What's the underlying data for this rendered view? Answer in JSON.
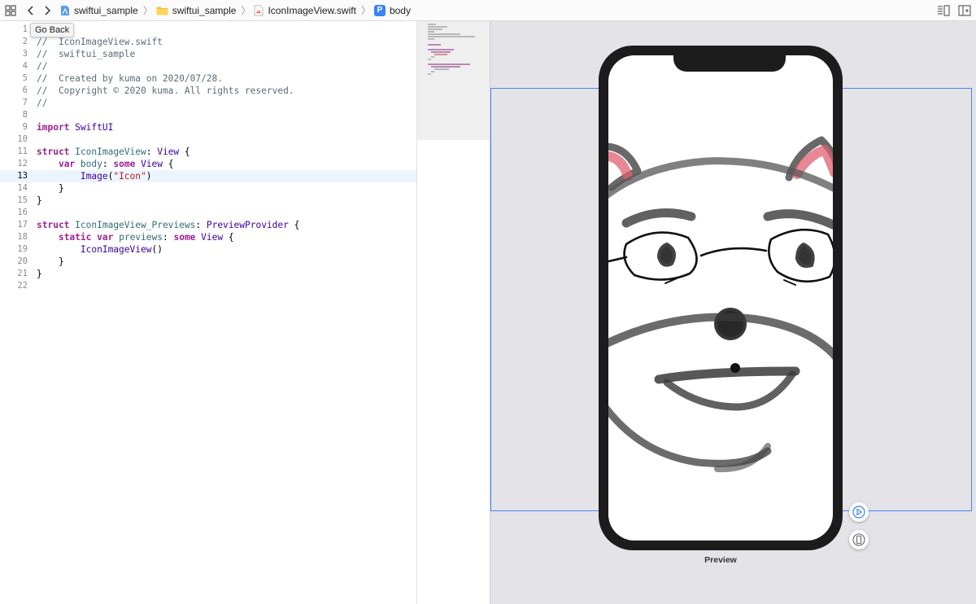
{
  "jumpbar": {
    "crumbs": [
      {
        "label": "swiftui_sample",
        "icon": "project-icon"
      },
      {
        "label": "swiftui_sample",
        "icon": "folder-icon"
      },
      {
        "label": "IconImageView.swift",
        "icon": "swift-file-icon"
      },
      {
        "label": "body",
        "icon": "property-icon"
      }
    ],
    "property_badge": "P"
  },
  "tooltip": "Go Back",
  "editor": {
    "current_line": 13,
    "lines": [
      {
        "n": "1",
        "t": "//"
      },
      {
        "n": "2",
        "t": "//  IconImageView.swift"
      },
      {
        "n": "3",
        "t": "//  swiftui_sample"
      },
      {
        "n": "4",
        "t": "//"
      },
      {
        "n": "5",
        "t": "//  Created by kuma on 2020/07/28."
      },
      {
        "n": "6",
        "t": "//  Copyright © 2020 kuma. All rights reserved."
      },
      {
        "n": "7",
        "t": "//"
      },
      {
        "n": "8",
        "t": ""
      },
      {
        "n": "9",
        "t": "import SwiftUI"
      },
      {
        "n": "10",
        "t": ""
      },
      {
        "n": "11",
        "t": "struct IconImageView: View {"
      },
      {
        "n": "12",
        "t": "    var body: some View {"
      },
      {
        "n": "13",
        "t": "        Image(\"Icon\")"
      },
      {
        "n": "14",
        "t": "    }"
      },
      {
        "n": "15",
        "t": "}"
      },
      {
        "n": "16",
        "t": ""
      },
      {
        "n": "17",
        "t": "struct IconImageView_Previews: PreviewProvider {"
      },
      {
        "n": "18",
        "t": "    static var previews: some View {"
      },
      {
        "n": "19",
        "t": "        IconImageView()"
      },
      {
        "n": "20",
        "t": "    }"
      },
      {
        "n": "21",
        "t": "}"
      },
      {
        "n": "22",
        "t": ""
      }
    ]
  },
  "canvas": {
    "preview_label": "Preview",
    "selection_color": "#4a86f0"
  }
}
